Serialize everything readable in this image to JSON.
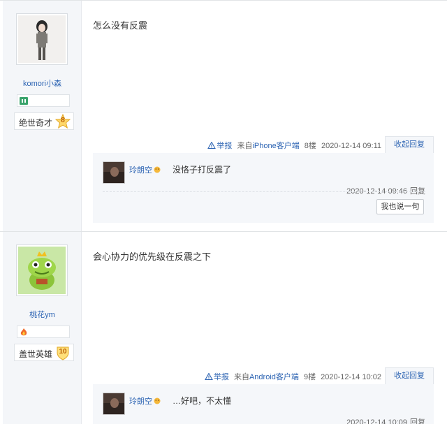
{
  "posts": [
    {
      "username": "komori小森",
      "level_name": "绝世奇才",
      "level_num": "8",
      "content": "怎么没有反震",
      "report": "举报",
      "source_prefix": "来自",
      "source_link": "iPhone客户端",
      "floor": "8楼",
      "time": "2020-12-14 09:11",
      "collapse": "收起回复",
      "replies": [
        {
          "name": "玲朗空",
          "text": "没恪子打反震了",
          "time": "2020-12-14 09:46",
          "reply_label": "回复"
        }
      ],
      "say_button": "我也说一句"
    },
    {
      "username": "桃花ym",
      "level_name": "盖世英雄",
      "level_num": "10",
      "content": "会心协力的优先级在反震之下",
      "report": "举报",
      "source_prefix": "来自",
      "source_link": "Android客户端",
      "floor": "9楼",
      "time": "2020-12-14 10:02",
      "collapse": "收起回复",
      "replies": [
        {
          "name": "玲朗空",
          "text": "…好吧，不太懂",
          "time": "2020-12-14 10:09",
          "reply_label": "回复"
        }
      ]
    }
  ],
  "colors": {
    "link": "#2d64b3",
    "sidebar_bg": "#f4f6f9",
    "reply_bg": "#f5f7fa"
  },
  "icons": [
    "warning-icon",
    "emoji-icon",
    "member-icon",
    "fire-icon",
    "level-star-icon",
    "level-shield-icon"
  ]
}
